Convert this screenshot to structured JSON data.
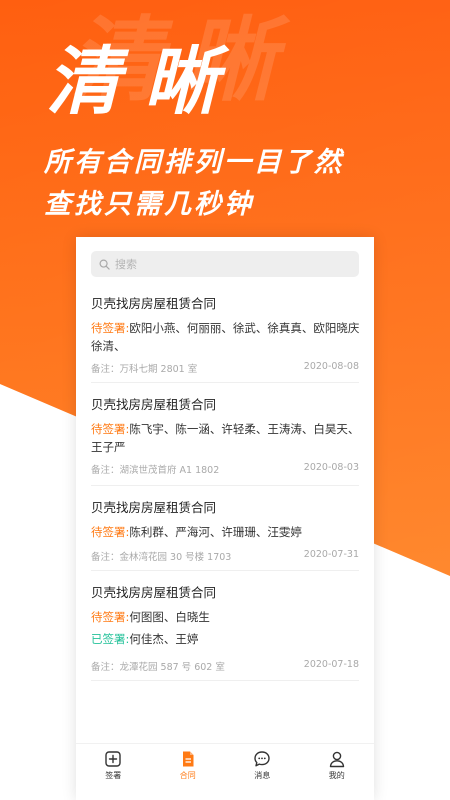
{
  "hero": {
    "watermark": "清晰",
    "title": "清晰",
    "line1": "所有合同排列一目了然",
    "line2": "查找只需几秒钟"
  },
  "search": {
    "placeholder": "搜索",
    "icon": "search-icon"
  },
  "contracts": [
    {
      "title": "贝壳找房房屋租赁合同",
      "pending_label": "待签署:",
      "pending_names": "欧阳小燕、何丽丽、徐武、徐真真、欧阳晓庆徐清、",
      "note": "备注：万科七期 2801 室",
      "date": "2020-08-08"
    },
    {
      "title": "贝壳找房房屋租赁合同",
      "pending_label": "待签署:",
      "pending_names": "陈飞宇、陈一涵、许轻柔、王涛涛、白昊天、王子严",
      "note": "备注：湖滨世茂首府 A1 1802",
      "date": "2020-08-03"
    },
    {
      "title": "贝壳找房房屋租赁合同",
      "pending_label": "待签署:",
      "pending_names": "陈利群、严海河、许珊珊、汪雯婷",
      "note": "备注：金林湾花园 30 号楼 1703",
      "date": "2020-07-31"
    },
    {
      "title": "贝壳找房房屋租赁合同",
      "pending_label": "待签署:",
      "pending_names": "何图图、白晓生",
      "signed_label": "已签署:",
      "signed_names": "何佳杰、王婷",
      "note": "备注：龙潭花园 587 号 602 室",
      "date": "2020-07-18"
    }
  ],
  "tabs": [
    {
      "label": "签署",
      "icon": "plus-square-icon"
    },
    {
      "label": "合同",
      "icon": "document-icon"
    },
    {
      "label": "消息",
      "icon": "chat-bubble-icon"
    },
    {
      "label": "我的",
      "icon": "person-icon"
    }
  ],
  "colors": {
    "accent": "#ff7a14",
    "signed": "#25c29a",
    "background": "#ff6a12"
  }
}
